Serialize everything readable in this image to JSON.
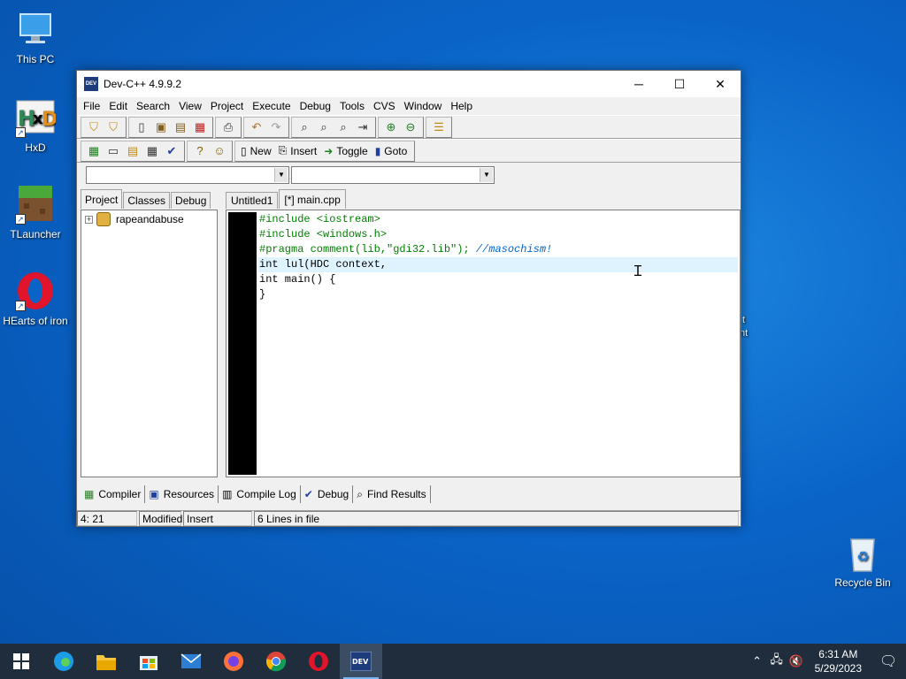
{
  "desktop": {
    "icons": [
      {
        "label": "This PC",
        "icon": "computer-icon"
      },
      {
        "label": "HxD",
        "icon": "hxd-icon"
      },
      {
        "label": "TLauncher",
        "icon": "tlauncher-icon"
      },
      {
        "label": "HEarts of iron",
        "icon": "opera-icon"
      },
      {
        "label": "Recycle Bin",
        "icon": "recycle-bin-icon"
      }
    ],
    "stray_text": [
      "t",
      "nt"
    ]
  },
  "window": {
    "title": "Dev-C++ 4.9.9.2",
    "app_icon_text": "DEV",
    "menu": [
      "File",
      "Edit",
      "Search",
      "View",
      "Project",
      "Execute",
      "Debug",
      "Tools",
      "CVS",
      "Window",
      "Help"
    ],
    "toolbar2_buttons": {
      "new": "New",
      "insert": "Insert",
      "toggle": "Toggle",
      "goto": "Goto"
    },
    "left_tabs": [
      "Project",
      "Classes",
      "Debug"
    ],
    "project_tree": {
      "root": "rapeandabuse"
    },
    "editor_tabs": [
      "Untitled1",
      "[*] main.cpp"
    ],
    "code_lines": [
      "#include <iostream>",
      "#include <windows.h>",
      "#pragma comment(lib,\"gdi32.lib\"); //masochism!",
      "int lul(HDC context,",
      "int main() {",
      "}"
    ],
    "current_line": 4,
    "bottom_tabs": [
      "Compiler",
      "Resources",
      "Compile Log",
      "Debug",
      "Find Results"
    ],
    "status": {
      "position": "4: 21",
      "modified": "Modified",
      "mode": "Insert",
      "lines": "6 Lines in file"
    }
  },
  "taskbar": {
    "apps": [
      "start-icon",
      "edge-icon",
      "file-explorer-icon",
      "store-icon",
      "mail-icon",
      "firefox-icon",
      "chrome-icon",
      "opera-icon",
      "devcpp-icon"
    ],
    "time": "6:31 AM",
    "date": "5/29/2023"
  },
  "colors": {
    "desktop_bg": "#0a64c8",
    "taskbar_bg": "#1f2d3d",
    "preprocessor": "#008000",
    "string": "#008000",
    "comment": "#0066cc",
    "current_line_bg": "#dff3ff"
  }
}
